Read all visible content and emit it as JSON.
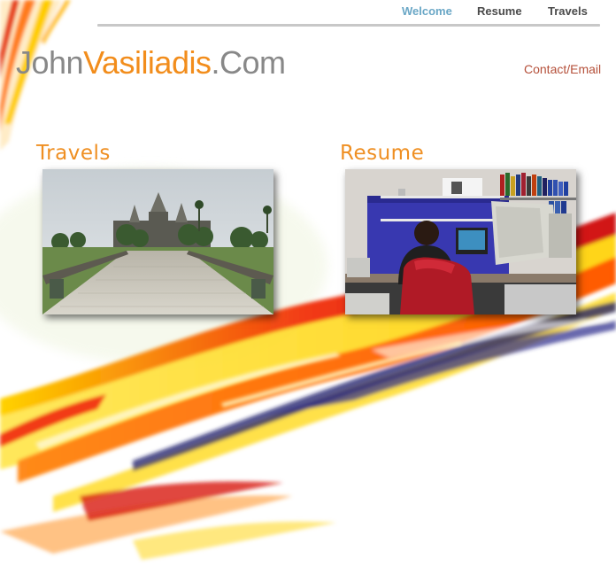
{
  "nav": {
    "items": [
      {
        "label": "Welcome",
        "active": true
      },
      {
        "label": "Resume",
        "active": false
      },
      {
        "label": "Travels",
        "active": false
      }
    ]
  },
  "brand": {
    "part1": "John",
    "part2": "Vasiliadis",
    "part3": ".Com"
  },
  "contact": {
    "label": "Contact/Email"
  },
  "sections": {
    "travels": {
      "title": "Travels",
      "image": "temple-causeway-photo"
    },
    "resume": {
      "title": "Resume",
      "image": "computer-lab-photo"
    }
  },
  "colors": {
    "accent_orange": "#f28d1c",
    "nav_active": "#6aa7c6",
    "nav_default": "#4a4a4a",
    "contact_link": "#b5503a",
    "brand_gray": "#888888"
  }
}
